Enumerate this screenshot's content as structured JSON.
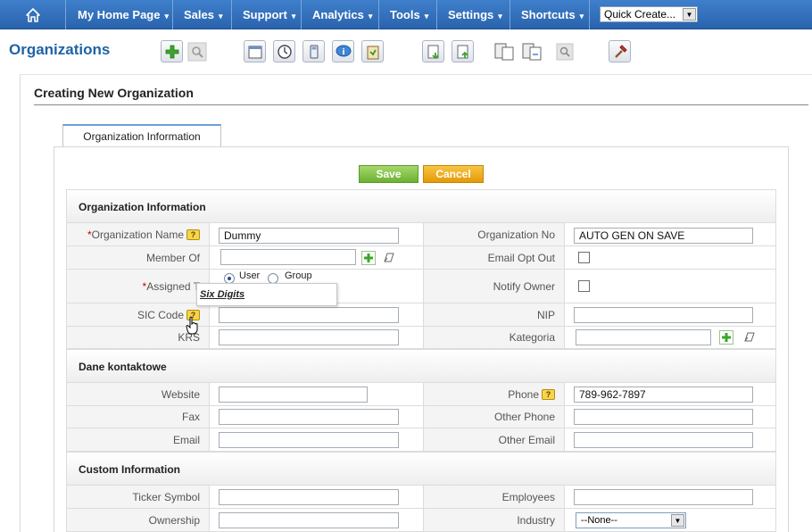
{
  "nav": {
    "home_icon": "home-icon",
    "items": [
      "My Home Page",
      "Sales",
      "Support",
      "Analytics",
      "Tools",
      "Settings",
      "Shortcuts"
    ],
    "caret": "▾",
    "quick_create": "Quick Create...",
    "select_arrow": "▼"
  },
  "page": {
    "title": "Organizations",
    "form_title": "Creating New Organization",
    "tab": "Organization Information",
    "save": "Save",
    "cancel": "Cancel"
  },
  "sections": {
    "org_info": "Organization Information",
    "contact": "Dane kontaktowe",
    "custom": "Custom Information"
  },
  "fields": {
    "req": "*",
    "help": "?",
    "org_name_label": "Organization Name",
    "org_name_value": "Dummy",
    "org_no_label": "Organization No",
    "org_no_value": "AUTO GEN ON SAVE",
    "member_of_label": "Member Of",
    "email_opt_out_label": "Email Opt Out",
    "assigned_label": "Assigned T",
    "assign_user": "User",
    "assign_group": "Group",
    "notify_owner_label": "Notify Owner",
    "sic_label": "SIC Code",
    "nip_label": "NIP",
    "krs_label": "KRS",
    "kategoria_label": "Kategoria",
    "website_label": "Website",
    "phone_label": "Phone",
    "phone_value": "789-962-7897",
    "fax_label": "Fax",
    "other_phone_label": "Other Phone",
    "email_label": "Email",
    "other_email_label": "Other Email",
    "ticker_label": "Ticker Symbol",
    "employees_label": "Employees",
    "ownership_label": "Ownership",
    "industry_label": "Industry",
    "industry_value": "--None--"
  },
  "tooltip": "Six Digits",
  "colors": {
    "nav_bg": "#2f6fbd",
    "title": "#1f63a6",
    "save": "#6cb033",
    "cancel": "#e59a06"
  }
}
